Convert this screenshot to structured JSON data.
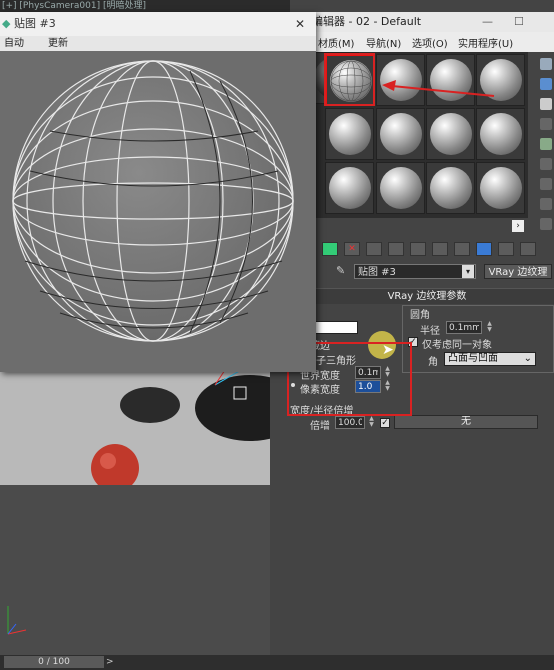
{
  "viewport": {
    "label": "[+] [PhysCamera001] [明暗处理]",
    "timeline_range": "0 / 100",
    "timeline_arrow": ">"
  },
  "material_editor": {
    "title": "编辑器 - 02 - Default",
    "menus": [
      "材质(M)",
      "导航(N)",
      "选项(O)",
      "实用程序(U)"
    ],
    "window_controls": [
      "—",
      "☐"
    ],
    "map_name": "贴图 #3",
    "map_type": "VRay 边纹理",
    "rollout_title": "VRay 边纹理参数",
    "params": {
      "hidden_edges_label": "隐藏边",
      "show_subtriangles_label": "显示子三角形",
      "world_width_label": "世界宽度",
      "world_width_value": "0.1mm",
      "pixel_width_label": "像素宽度",
      "pixel_width_value": "1.0",
      "rounded_corners_label": "圆角",
      "radius_label": "半径",
      "radius_value": "0.1mm",
      "same_object_label": "仅考虑同一对象",
      "corners_label": "角",
      "corners_option": "凸面与凹面",
      "width_radius_multiplier_label": "宽度/半径倍增",
      "multiplier_label": "倍增",
      "multiplier_value": "100.0",
      "none_label": "无"
    }
  },
  "texture_window": {
    "title": "贴图 #3",
    "close_glyph": "✕",
    "menus": [
      "自动",
      "更新"
    ]
  },
  "colors": {
    "annotation_red": "#d92222",
    "swatch_white": "#ffffff",
    "highlight_yellow": "#d8c84a"
  }
}
